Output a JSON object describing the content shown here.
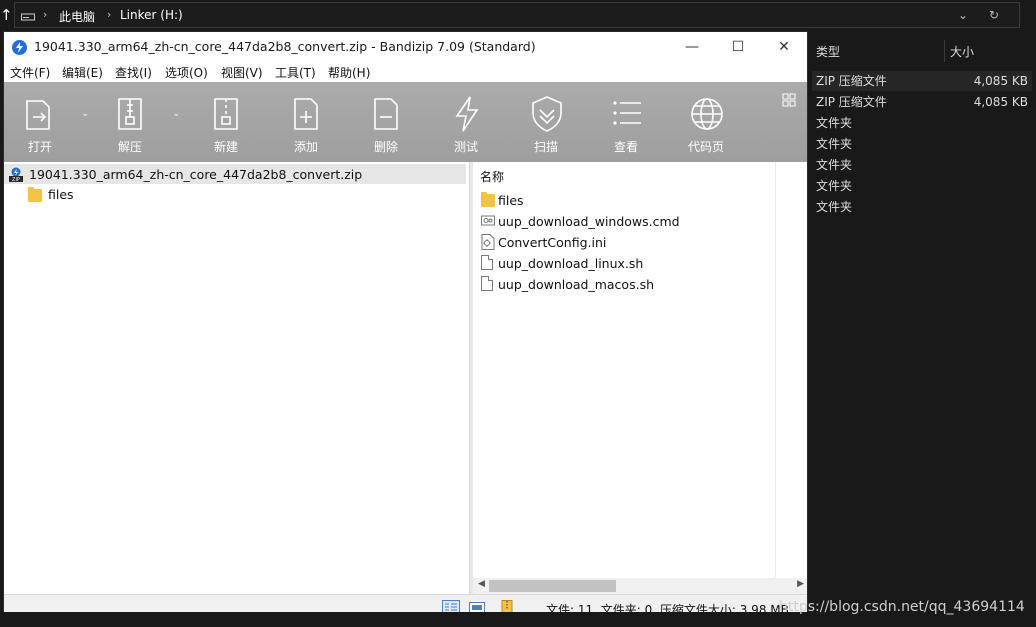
{
  "explorer": {
    "breadcrumb": [
      "此电脑",
      "Linker (H:)"
    ],
    "columns": {
      "type": "类型",
      "size": "大小"
    },
    "rows": [
      {
        "type": "ZIP 压缩文件",
        "size": "4,085 KB"
      },
      {
        "type": "ZIP 压缩文件",
        "size": "4,085 KB"
      },
      {
        "type": "文件夹",
        "size": ""
      },
      {
        "type": "文件夹",
        "size": ""
      },
      {
        "type": "文件夹",
        "size": ""
      },
      {
        "type": "文件夹",
        "size": ""
      },
      {
        "type": "文件夹",
        "size": ""
      }
    ]
  },
  "window": {
    "title": "19041.330_arm64_zh-cn_core_447da2b8_convert.zip - Bandizip 7.09 (Standard)",
    "controls": {
      "minimize": "—",
      "maximize": "☐",
      "close": "✕"
    }
  },
  "menu": [
    "文件(F)",
    "编辑(E)",
    "查找(I)",
    "选项(O)",
    "视图(V)",
    "工具(T)",
    "帮助(H)"
  ],
  "toolbar": {
    "buttons": [
      {
        "label": "打开",
        "icon": "open-icon"
      },
      {
        "label": "解压",
        "icon": "extract-icon"
      },
      {
        "label": "新建",
        "icon": "new-archive-icon"
      },
      {
        "label": "添加",
        "icon": "add-file-icon"
      },
      {
        "label": "删除",
        "icon": "delete-file-icon"
      },
      {
        "label": "测试",
        "icon": "test-icon"
      },
      {
        "label": "扫描",
        "icon": "scan-shield-icon"
      },
      {
        "label": "查看",
        "icon": "view-list-icon"
      },
      {
        "label": "代码页",
        "icon": "codepage-globe-icon"
      }
    ]
  },
  "tree": {
    "root": "19041.330_arm64_zh-cn_core_447da2b8_convert.zip",
    "children": [
      "files"
    ]
  },
  "filelist": {
    "header": "名称",
    "items": [
      {
        "name": "files",
        "icon": "folder-icon"
      },
      {
        "name": "uup_download_windows.cmd",
        "icon": "cmd-file-icon"
      },
      {
        "name": "ConvertConfig.ini",
        "icon": "ini-file-icon"
      },
      {
        "name": "uup_download_linux.sh",
        "icon": "file-icon"
      },
      {
        "name": "uup_download_macos.sh",
        "icon": "file-icon"
      }
    ]
  },
  "status": {
    "text": "文件: 11, 文件夹: 0, 压缩文件大小: 3.98 MB"
  },
  "watermark": "https://blog.csdn.net/qq_43694114"
}
